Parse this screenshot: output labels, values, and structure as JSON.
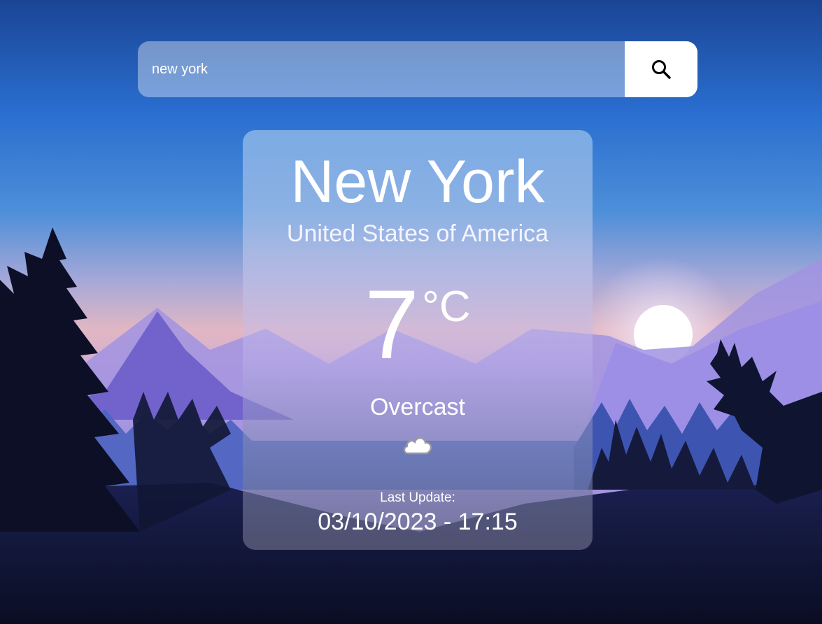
{
  "search": {
    "value": "new york",
    "icon": "search-icon"
  },
  "weather": {
    "city": "New York",
    "country": "United States of America",
    "temperature": "7",
    "unit": "°C",
    "condition": "Overcast",
    "condition_icon": "cloud-icon",
    "last_update_label": "Last Update:",
    "last_update_time": "03/10/2023 - 17:15"
  },
  "colors": {
    "sky_top": "#1a4fa0",
    "sky_mid": "#2f7fd4",
    "horizon": "#e6b8c0",
    "mountain": "#7a66d6",
    "forest": "#0e1330"
  }
}
